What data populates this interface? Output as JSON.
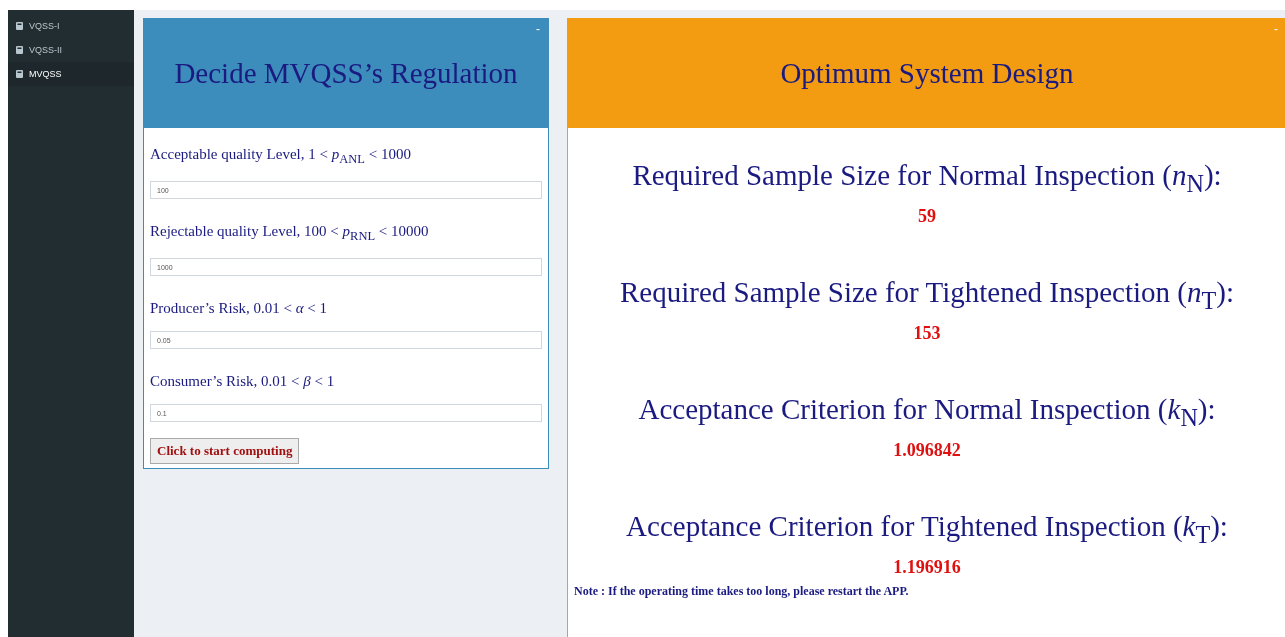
{
  "sidebar": {
    "items": [
      {
        "label": "VQSS-I",
        "selected": false
      },
      {
        "label": "VQSS-II",
        "selected": false
      },
      {
        "label": "MVQSS",
        "selected": true
      }
    ]
  },
  "input_panel": {
    "title": "Decide MVQSS’s Regulation",
    "collapse": "-",
    "fields": [
      {
        "label": "Acceptable quality Level, 1 < *p*$_{ANL}$ < 1000",
        "value": "100"
      },
      {
        "label": "Rejectable quality Level, 100 < *p*$_{RNL}$ < 10000",
        "value": "1000"
      },
      {
        "label": "Producer’s Risk, 0.01 < *α* < 1",
        "value": "0.05"
      },
      {
        "label": "Consumer’s Risk, 0.01 < *β* < 1",
        "value": "0.1"
      }
    ],
    "button": "Click to start computing"
  },
  "result_panel": {
    "title": "Optimum System Design",
    "collapse": "-",
    "results": [
      {
        "heading": "Required Sample Size for Normal Inspection (*n*$_{N}$):",
        "value": "59"
      },
      {
        "heading": "Required Sample Size for Tightened Inspection (*n*$_{T}$):",
        "value": "153"
      },
      {
        "heading": "Acceptance Criterion for Normal Inspection (*k*$_{N}$):",
        "value": "1.096842"
      },
      {
        "heading": "Acceptance Criterion for Tightened Inspection (*k*$_{T}$):",
        "value": "1.196916"
      }
    ],
    "note": "Note : If the operating time takes too long, please restart the APP."
  }
}
